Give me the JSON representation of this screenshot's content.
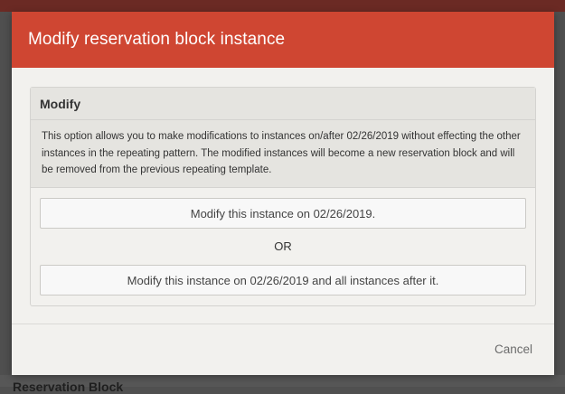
{
  "background": {
    "partial_heading": "Reservation Block"
  },
  "modal": {
    "title": "Modify reservation block instance",
    "header_color": "#cf4632",
    "panel": {
      "title": "Modify",
      "description": "This option allows you to make modifications to instances on/after 02/26/2019 without effecting the other instances in the repeating pattern. The modified instances will become a new reservation block and will be removed from the previous repeating template.",
      "option_single": "Modify this instance on 02/26/2019.",
      "separator": "OR",
      "option_all_after": "Modify this instance on 02/26/2019 and all instances after it."
    },
    "footer": {
      "cancel_label": "Cancel"
    }
  }
}
